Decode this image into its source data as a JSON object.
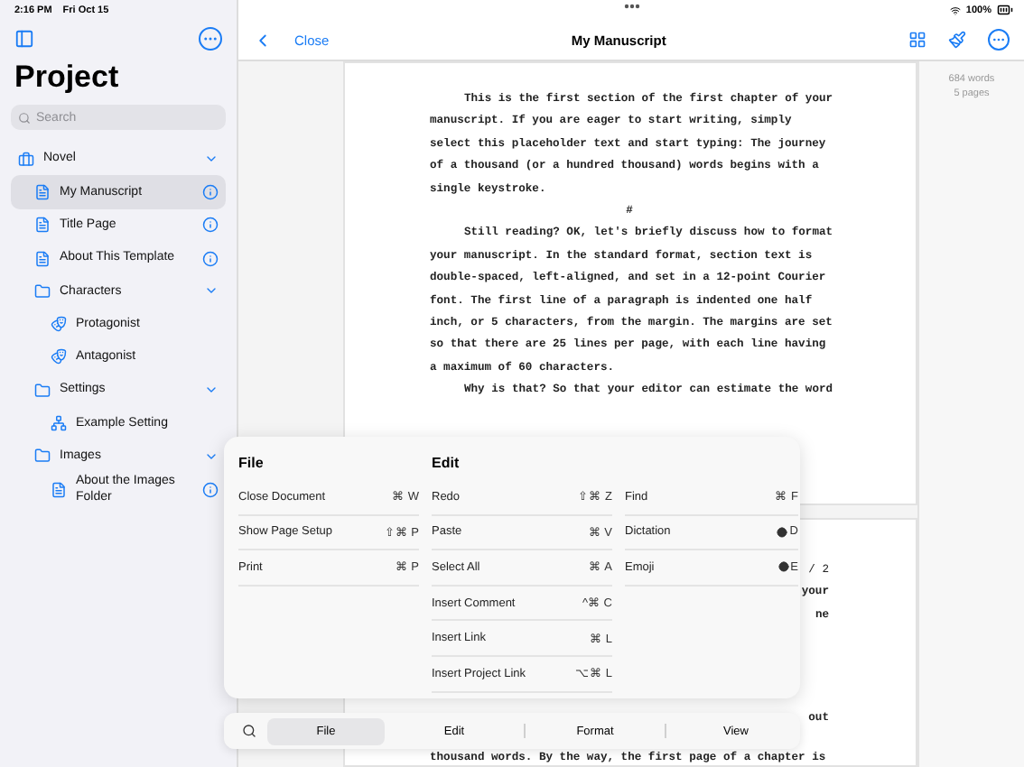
{
  "status_bar": {
    "time": "2:16 PM",
    "date": "Fri Oct 15",
    "battery": "100%"
  },
  "sidebar": {
    "title": "Project",
    "search": {
      "placeholder": "Search"
    },
    "items": [
      {
        "label": "Novel",
        "kind": "binder",
        "expanded": true,
        "selected": false,
        "children": [
          {
            "label": "My Manuscript",
            "kind": "document",
            "selected": true
          },
          {
            "label": "Title Page",
            "kind": "document",
            "selected": false
          },
          {
            "label": "About This Template",
            "kind": "document",
            "selected": false
          },
          {
            "label": "Characters",
            "kind": "folder",
            "expanded": true,
            "selected": false,
            "children": [
              {
                "label": "Protagonist",
                "kind": "character",
                "selected": false
              },
              {
                "label": "Antagonist",
                "kind": "character",
                "selected": false
              }
            ]
          },
          {
            "label": "Settings",
            "kind": "folder",
            "expanded": true,
            "selected": false,
            "children": [
              {
                "label": "Example Setting",
                "kind": "setting",
                "selected": false
              }
            ]
          },
          {
            "label": "Images",
            "kind": "folder",
            "expanded": true,
            "selected": false,
            "children": [
              {
                "label": "About the Images Folder",
                "kind": "document",
                "selected": false
              }
            ]
          }
        ]
      }
    ]
  },
  "nav_bar": {
    "close": "Close",
    "title": "My Manuscript"
  },
  "stats": [
    "684 words",
    "5 pages"
  ],
  "page_1": [
    {
      "kind": "paragraph",
      "lines": [
        "This is the first section of the first chapter of your",
        "manuscript. If you are eager to start writing, simply",
        "select this placeholder text and start typing: The journey",
        "of a thousand (or a hundred thousand) words begins with a",
        "single keystroke."
      ]
    },
    {
      "kind": "break",
      "lines": [
        "#"
      ]
    },
    {
      "kind": "paragraph",
      "lines": [
        "Still reading? OK, let's briefly discuss how to format",
        "your manuscript. In the standard format, section text is",
        "double-spaced, left-aligned, and set in a 12-point Courier",
        "font. The first line of a paragraph is indented one half",
        "inch, or 5 characters, from the margin. The margins are set",
        "so that there are 25 lines per page, with each line having",
        "a maximum of 60 characters."
      ]
    },
    {
      "kind": "paragraph",
      "lines": [
        "Why is that? So that your editor can estimate the word"
      ]
    }
  ],
  "page_2": [
    {
      "kind": "header",
      "text": "/ 2"
    },
    {
      "kind": "line_end",
      "text": "your"
    },
    {
      "kind": "line_end",
      "text": "ne"
    },
    {
      "kind": "resume",
      "text": "out"
    },
    {
      "kind": "line",
      "text": "thousand words. By the way, the first page of a chapter is"
    }
  ],
  "menu": {
    "columns": [
      {
        "heading": "File",
        "items": [
          {
            "label": "Close Document",
            "shortcut": "⌘ W",
            "globe": false
          },
          {
            "label": "Show Page Setup",
            "shortcut": "⇧⌘ P",
            "globe": false
          },
          {
            "label": "Print",
            "shortcut": "⌘ P",
            "globe": false
          }
        ]
      },
      {
        "heading": "Edit",
        "items": [
          {
            "label": "Redo",
            "shortcut": "⇧⌘ Z",
            "globe": false
          },
          {
            "label": "Paste",
            "shortcut": "⌘ V",
            "globe": false
          },
          {
            "label": "Select All",
            "shortcut": "⌘ A",
            "globe": false
          },
          {
            "label": "Insert Comment",
            "shortcut": "^⌘ C",
            "globe": false
          },
          {
            "label": "Insert Link",
            "shortcut": "⌘ L",
            "globe": false
          },
          {
            "label": "Insert Project Link",
            "shortcut": "⌥⌘ L",
            "globe": false
          }
        ]
      },
      {
        "items": [
          {
            "label": "Find",
            "shortcut": "⌘ F",
            "globe": false
          },
          {
            "label": "Dictation",
            "shortcut": "D",
            "globe": true
          },
          {
            "label": "Emoji",
            "shortcut": "E",
            "globe": true
          }
        ]
      }
    ]
  },
  "bottom_tabs": [
    {
      "label": "File",
      "selected": true
    },
    {
      "label": "Edit",
      "selected": false
    },
    {
      "label": "Format",
      "selected": false
    },
    {
      "label": "View",
      "selected": false
    }
  ]
}
